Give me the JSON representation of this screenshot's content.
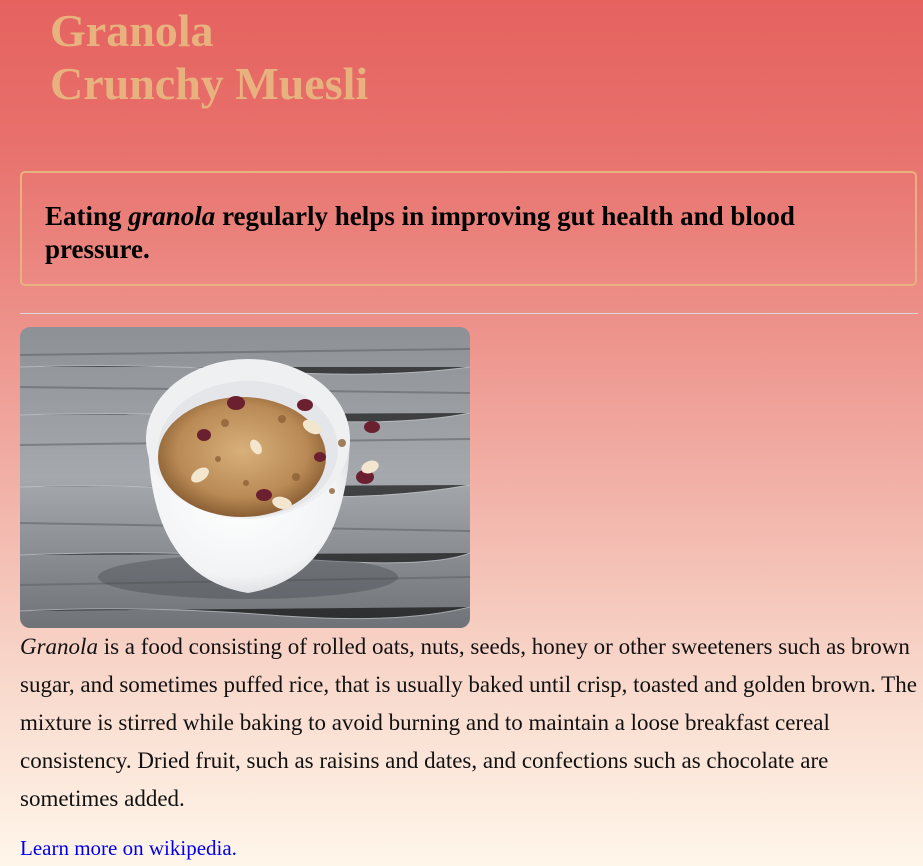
{
  "header": {
    "title_line1": "Granola",
    "title_line2": "Crunchy Muesli",
    "title_color": "#e8b27e"
  },
  "callout": {
    "prefix": "Eating ",
    "emphasis": "granola",
    "suffix": " regularly helps in improving gut health and blood pressure.",
    "border_color": "#e8b27e"
  },
  "image": {
    "alt": "Granola"
  },
  "description": {
    "emphasis": "Granola",
    "text": " is a food consisting of rolled oats, nuts, seeds, honey or other sweeteners such as brown sugar, and sometimes puffed rice, that is usually baked until crisp, toasted and golden brown. The mixture is stirred while baking to avoid burning and to maintain a loose breakfast cereal consistency. Dried fruit, such as raisins and dates, and confections such as chocolate are sometimes added."
  },
  "link": {
    "label": "Learn more on wikipedia.",
    "color": "#0000ee"
  },
  "background": {
    "top_color": "#e5625f",
    "bottom_color": "#fff6ea"
  }
}
